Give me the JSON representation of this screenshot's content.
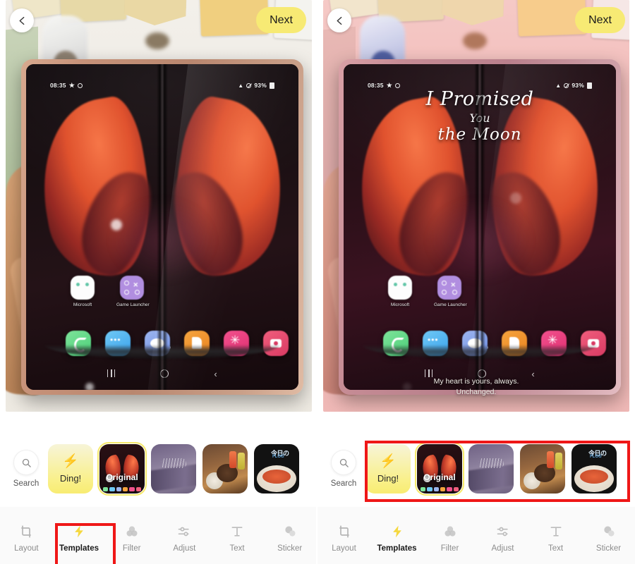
{
  "app": {
    "topbar": {
      "back_icon": "chevron-left-icon",
      "next_label": "Next"
    }
  },
  "photo": {
    "phone_status_bar": {
      "time": "08:35",
      "star_icon": "star-icon",
      "dnd_icon": "circle-icon",
      "wifi_icon": "wifi-icon",
      "mute_icon": "mute-icon",
      "battery_percent": "93%",
      "battery_icon": "battery-icon"
    },
    "home_apps": [
      {
        "label": "Microsoft",
        "icon": "microsoft-icon"
      },
      {
        "label": "Game Launcher",
        "icon": "game-launcher-icon"
      }
    ],
    "dock_icons": [
      "phone-icon",
      "messages-icon",
      "internet-icon",
      "folder-icon",
      "asterisk-icon",
      "camera-icon"
    ],
    "nav_icons": [
      "recents-icon",
      "home-icon",
      "back-icon"
    ]
  },
  "template_overlay": {
    "title_line1": "I Promised",
    "title_line2": "You",
    "title_line3": "the Moon",
    "footer_line1": "My heart is yours, always.",
    "footer_line2": "Unchanged."
  },
  "template_strip": {
    "search": {
      "label": "Search",
      "icon": "search-icon"
    },
    "items": [
      {
        "name": "Ding!",
        "label": "Ding!",
        "icon": "bolt-icon",
        "selected": false
      },
      {
        "name": "Original",
        "label": "Original",
        "selected": true
      },
      {
        "name": "Mountain",
        "label": "",
        "selected": false
      },
      {
        "name": "Food",
        "label": "",
        "selected": false
      },
      {
        "name": "Noodle",
        "label": "",
        "selected": false
      }
    ]
  },
  "bottom_nav": {
    "items": [
      {
        "label": "Layout",
        "icon": "crop-icon",
        "active": false
      },
      {
        "label": "Templates",
        "icon": "bolt-icon",
        "active": true
      },
      {
        "label": "Filter",
        "icon": "circles-icon",
        "active": false
      },
      {
        "label": "Adjust",
        "icon": "sliders-icon",
        "active": false
      },
      {
        "label": "Text",
        "icon": "text-icon",
        "active": false
      },
      {
        "label": "Sticker",
        "icon": "sticker-icon",
        "active": false
      }
    ]
  },
  "annotations": {
    "colors": {
      "highlight": "#EF1717",
      "accent_yellow": "#F7EA74",
      "selected_outline": "#F6E96A"
    },
    "boxes": [
      {
        "name": "templates-tab-highlight"
      },
      {
        "name": "template-strip-highlight"
      }
    ]
  }
}
